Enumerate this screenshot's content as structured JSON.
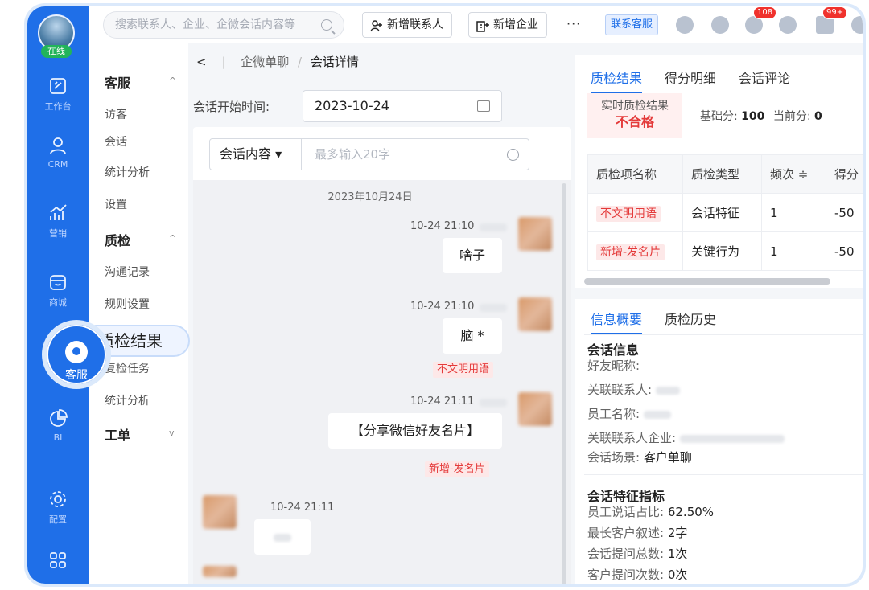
{
  "status": {
    "online": "在线"
  },
  "rail": [
    {
      "label": "工作台",
      "icon": "workbench-icon"
    },
    {
      "label": "CRM",
      "icon": "person-icon"
    },
    {
      "label": "营销",
      "icon": "marketing-icon"
    },
    {
      "label": "商城",
      "icon": "store-icon"
    },
    {
      "label": "客服",
      "icon": "customer-service-icon"
    },
    {
      "label": "BI",
      "icon": "pie-chart-icon"
    },
    {
      "label": "配置",
      "icon": "gear-icon"
    },
    {
      "label": "",
      "icon": "apps-grid-icon"
    }
  ],
  "tooltip": "质检结果",
  "topbar": {
    "search_placeholder": "搜索联系人、企业、企微会话内容等",
    "add_contact": "新增联系人",
    "add_company": "新增企业",
    "more": "···",
    "service": "联系客服",
    "badge_download": "108",
    "badge_bell": "99+"
  },
  "nav": {
    "kefu": "客服",
    "kefu_items": [
      "访客",
      "会话",
      "统计分析",
      "设置"
    ],
    "zhijian": "质检",
    "zhijian_items": [
      "沟通记录",
      "规则设置",
      "复检任务",
      "统计分析"
    ],
    "gongdan": "工单"
  },
  "breadcrumb": {
    "parent": "企微单聊",
    "sep": "/",
    "current": "会话详情"
  },
  "session": {
    "start_label": "会话开始时间:",
    "start_date": "2023-10-24"
  },
  "filter": {
    "select": "会话内容 ▾",
    "placeholder": "最多输入20字"
  },
  "chat": {
    "date": "2023年10月24日",
    "messages": [
      {
        "time": "10-24 21:10",
        "text": "啥子",
        "tag": ""
      },
      {
        "time": "10-24 21:10",
        "text": "脑 *",
        "tag": "不文明用语"
      },
      {
        "time": "10-24 21:11",
        "text": "【分享微信好友名片】",
        "tag": "新增-发名片"
      },
      {
        "time": "10-24 21:11",
        "text": "",
        "tag": ""
      }
    ]
  },
  "qc": {
    "tabs": [
      "质检结果",
      "得分明细",
      "会话评论"
    ],
    "realtime_label": "实时质检结果",
    "realtime_value": "不合格",
    "base_label": "基础分:",
    "base_value": "100",
    "current_label": "当前分:",
    "current_value": "0",
    "columns": [
      "质检项名称",
      "质检类型",
      "频次 ≑",
      "得分"
    ],
    "rows": [
      {
        "name": "不文明用语",
        "type": "会话特征",
        "freq": "1",
        "score": "-50"
      },
      {
        "name": "新增-发名片",
        "type": "关键行为",
        "freq": "1",
        "score": "-50"
      }
    ]
  },
  "info": {
    "tabs": [
      "信息概要",
      "质检历史"
    ],
    "session_title": "会话信息",
    "friend_nick": "好友昵称:",
    "related_contact": "关联联系人:",
    "staff_name": "员工名称:",
    "related_company": "关联联系人企业:",
    "scene_label": "会话场景:",
    "scene_value": "客户单聊",
    "metric_title": "会话特征指标",
    "staff_ratio_label": "员工说话占比:",
    "staff_ratio_value": "62.50%",
    "longest_label": "最长客户叙述:",
    "longest_value": "2字",
    "questions_label": "会话提问总数:",
    "questions_value": "1次",
    "cust_q_label": "客户提问次数:",
    "cust_q_value": "0次"
  }
}
